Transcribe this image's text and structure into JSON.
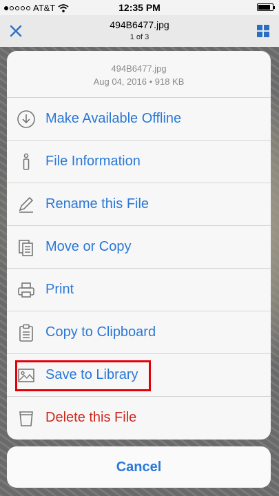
{
  "status_bar": {
    "carrier": "AT&T",
    "time": "12:35 PM",
    "battery_level": 0.85
  },
  "navbar": {
    "title": "494B6477.jpg",
    "subtitle": "1 of 3",
    "close_icon": "close-icon",
    "grid_icon": "grid-icon"
  },
  "sheet": {
    "filename": "494B6477.jpg",
    "meta": "Aug 04, 2016 • 918 KB",
    "items": [
      {
        "label": "Make Available Offline",
        "icon": "download-circle-icon"
      },
      {
        "label": "File Information",
        "icon": "info-icon"
      },
      {
        "label": "Rename this File",
        "icon": "pencil-icon"
      },
      {
        "label": "Move or Copy",
        "icon": "copy-documents-icon"
      },
      {
        "label": "Print",
        "icon": "printer-icon"
      },
      {
        "label": "Copy to Clipboard",
        "icon": "clipboard-icon"
      },
      {
        "label": "Save to Library",
        "icon": "image-icon"
      },
      {
        "label": "Delete this File",
        "icon": "trash-icon"
      }
    ]
  },
  "cancel": {
    "label": "Cancel"
  },
  "colors": {
    "accent": "#2a78d6",
    "destructive": "#d0271d",
    "highlight": "#e3000b"
  }
}
